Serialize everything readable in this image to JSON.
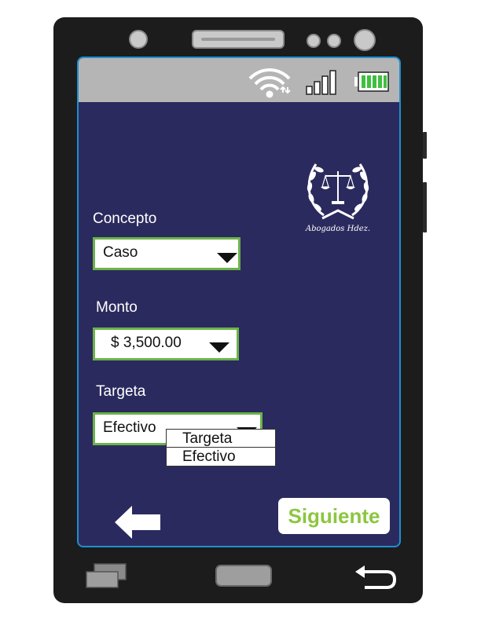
{
  "status_bar": {
    "icons": [
      "wifi-icon",
      "signal-bars-icon",
      "battery-icon"
    ],
    "accent": "#3fbf3f"
  },
  "logo": {
    "text": "Abogados Hdez."
  },
  "form": {
    "concepto": {
      "label": "Concepto",
      "value": "Caso"
    },
    "monto": {
      "label": "Monto",
      "value": "$ 3,500.00"
    },
    "targeta": {
      "label": "Targeta",
      "value": "Efectivo",
      "options": [
        "Targeta",
        "Efectivo"
      ]
    }
  },
  "actions": {
    "next_label": "Siguiente",
    "back_icon": "arrow-left-icon"
  },
  "nav_bar": {
    "icons": [
      "recent-apps-icon",
      "home-button",
      "back-nav-icon"
    ]
  },
  "colors": {
    "screen_bg": "#2b2a5e",
    "field_border": "#6bb34a",
    "next_text": "#8cc63f",
    "screen_border": "#1f8fd0"
  }
}
